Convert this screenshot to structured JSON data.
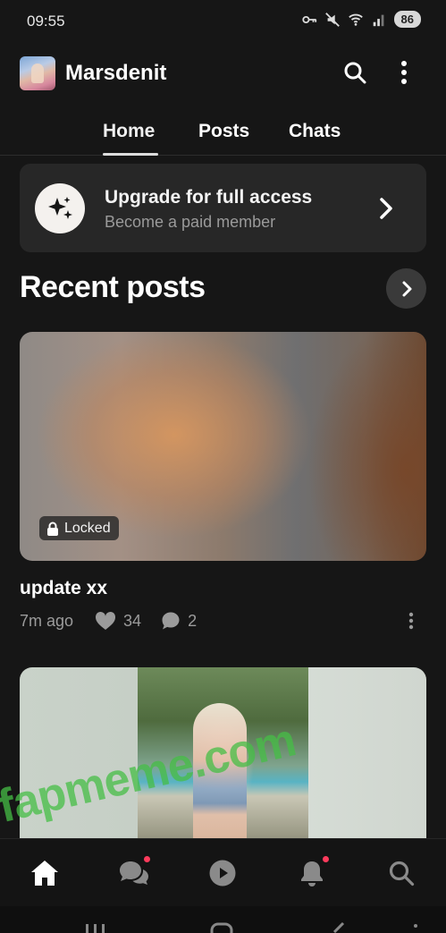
{
  "status_bar": {
    "time": "09:55",
    "battery": "86"
  },
  "header": {
    "title": "Marsdenit"
  },
  "tabs": [
    {
      "label": "Home",
      "active": true
    },
    {
      "label": "Posts",
      "active": false
    },
    {
      "label": "Chats",
      "active": false
    }
  ],
  "upgrade": {
    "title": "Upgrade for full access",
    "subtitle": "Become a paid member"
  },
  "recent": {
    "title": "Recent posts"
  },
  "posts": [
    {
      "locked_label": "Locked",
      "title": "update xx",
      "time": "7m ago",
      "likes": "34",
      "comments": "2"
    }
  ],
  "watermark": "fapmeme.com",
  "bottom_nav": {
    "items": [
      "home-icon",
      "chats-icon",
      "play-icon",
      "bell-icon",
      "search-icon"
    ],
    "badges": [
      "chats-icon",
      "bell-icon"
    ]
  },
  "colors": {
    "background": "#161616",
    "card": "#272727",
    "badge_dot": "#ff3b5c"
  }
}
